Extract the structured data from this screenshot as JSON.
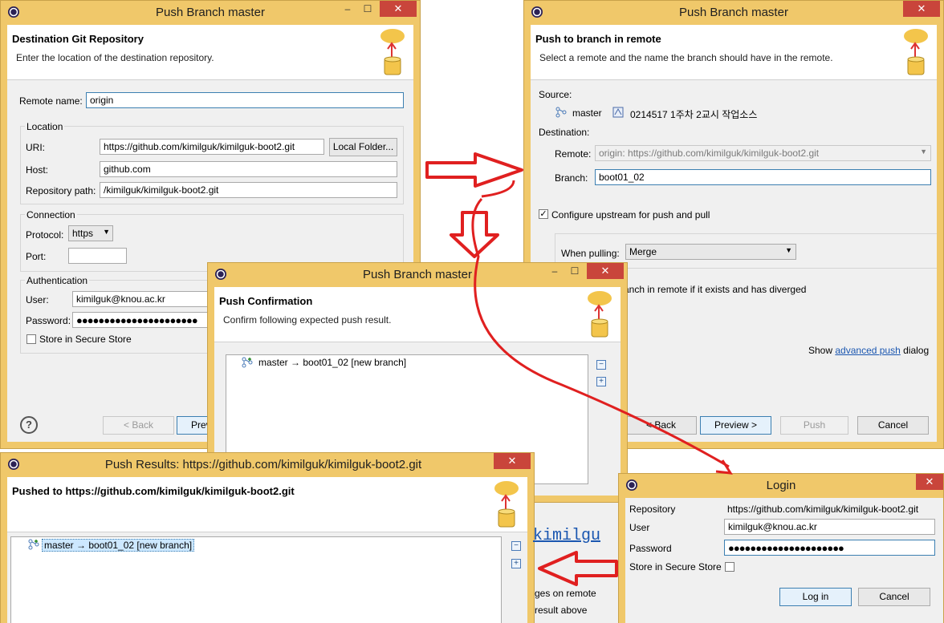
{
  "dest": {
    "title": "Push Branch master",
    "banner_title": "Destination Git Repository",
    "banner_desc": "Enter the location of the destination repository.",
    "remote_name_label": "Remote name:",
    "remote_name_value": "origin",
    "location_label": "Location",
    "uri_label": "URI:",
    "uri_value": "https://github.com/kimilguk/kimilguk-boot2.git",
    "local_folder_btn": "Local Folder...",
    "host_label": "Host:",
    "host_value": "github.com",
    "repo_path_label": "Repository path:",
    "repo_path_value": "/kimilguk/kimilguk-boot2.git",
    "connection_label": "Connection",
    "protocol_label": "Protocol:",
    "protocol_value": "https",
    "port_label": "Port:",
    "port_value": "",
    "auth_label": "Authentication",
    "user_label": "User:",
    "user_value": "kimilguk@knou.ac.kr",
    "password_label": "Password:",
    "password_value": "●●●●●●●●●●●●●●●●●●●●●●",
    "secure_store_label": "Store in Secure Store",
    "help": "?",
    "back_btn": "< Back",
    "preview_btn": "Preview >"
  },
  "remote": {
    "title": "Push Branch master",
    "banner_title": "Push to branch in remote",
    "banner_desc": "Select a remote and the name the branch should have in the remote.",
    "source_label": "Source:",
    "source_branch": "master",
    "source_commit": "0214517  1주차 2교시 작업소스",
    "destination_label": "Destination:",
    "remote_label": "Remote:",
    "remote_value": "origin: https://github.com/kimilguk/kimilguk-boot2.git",
    "branch_label": "Branch:",
    "branch_value": "boot01_02",
    "configure_upstream_label": "Configure upstream for push and pull",
    "when_pulling_label": "When pulling:",
    "when_pulling_value": "Merge",
    "force_text": "anch in remote if it exists and has diverged",
    "show_text": "Show",
    "advanced_push_link": "advanced push",
    "dialog_text": "dialog",
    "back_btn": "< Back",
    "preview_btn": "Preview >",
    "push_btn": "Push",
    "cancel_btn": "Cancel"
  },
  "confirm": {
    "title": "Push Branch master",
    "banner_title": "Push Confirmation",
    "banner_desc": "Confirm following expected push result.",
    "item": "master → boot01_02 [new branch]"
  },
  "results": {
    "title": "Push Results: https://github.com/kimilguk/kimilguk-boot2.git",
    "banner_title": "Pushed to https://github.com/kimilguk/kimilguk-boot2.git",
    "item": "master → boot01_02 [new branch]",
    "behind_link_partial": "kimilgu",
    "behind_text1": "ges on remote",
    "behind_text2": "result above"
  },
  "login": {
    "title": "Login",
    "repository_label": "Repository",
    "repository_value": "https://github.com/kimilguk/kimilguk-boot2.git",
    "user_label": "User",
    "user_value": "kimilguk@knou.ac.kr",
    "password_label": "Password",
    "password_value": "●●●●●●●●●●●●●●●●●●●●●",
    "secure_store_label": "Store in Secure Store",
    "login_btn": "Log in",
    "cancel_btn": "Cancel"
  },
  "window_controls": {
    "close": "✕",
    "minimize": "–",
    "maximize": "☐"
  },
  "colors": {
    "titlebar": "#f0c86a",
    "close": "#c9453b",
    "arrow": "#e02020",
    "link": "#1a56b0"
  }
}
